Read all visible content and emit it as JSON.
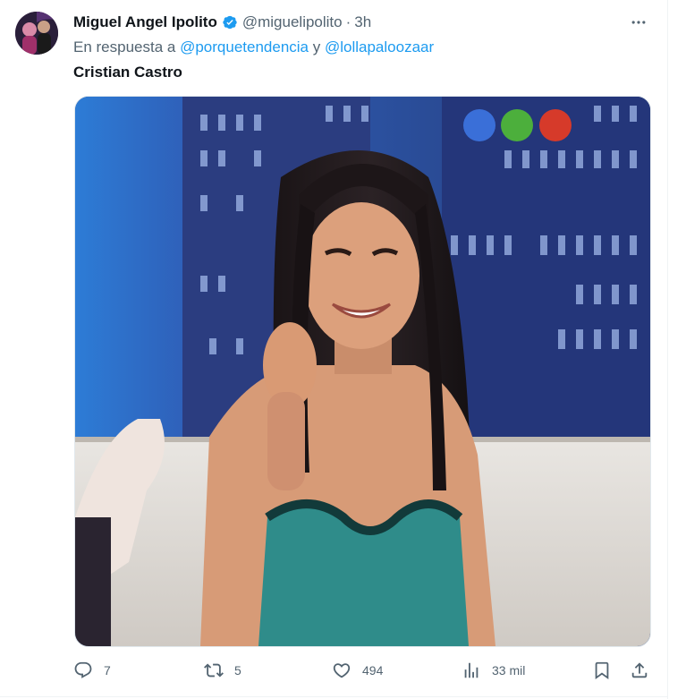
{
  "tweet": {
    "author": {
      "name": "Miguel Angel Ipolito",
      "handle": "@miguelipolito",
      "time": "3h",
      "separator": "·"
    },
    "reply": {
      "prefix": "En respuesta a",
      "mention1": "@porquetendencia",
      "conjunction": "y",
      "mention2": "@lollapaloozaar"
    },
    "text": "Cristian Castro",
    "media": {
      "type": "photo",
      "description_icon": "photo"
    },
    "stats": {
      "replies": "7",
      "retweets": "5",
      "likes": "494",
      "views": "33 mil"
    }
  },
  "icons": {
    "verified": "verified-badge-icon",
    "more": "more-icon",
    "reply": "reply-icon",
    "retweet": "retweet-icon",
    "like": "like-icon",
    "views": "views-icon",
    "bookmark": "bookmark-icon",
    "share": "share-icon"
  },
  "colors": {
    "accent": "#1d9bf0",
    "text": "#0f1419",
    "muted": "#536471"
  }
}
